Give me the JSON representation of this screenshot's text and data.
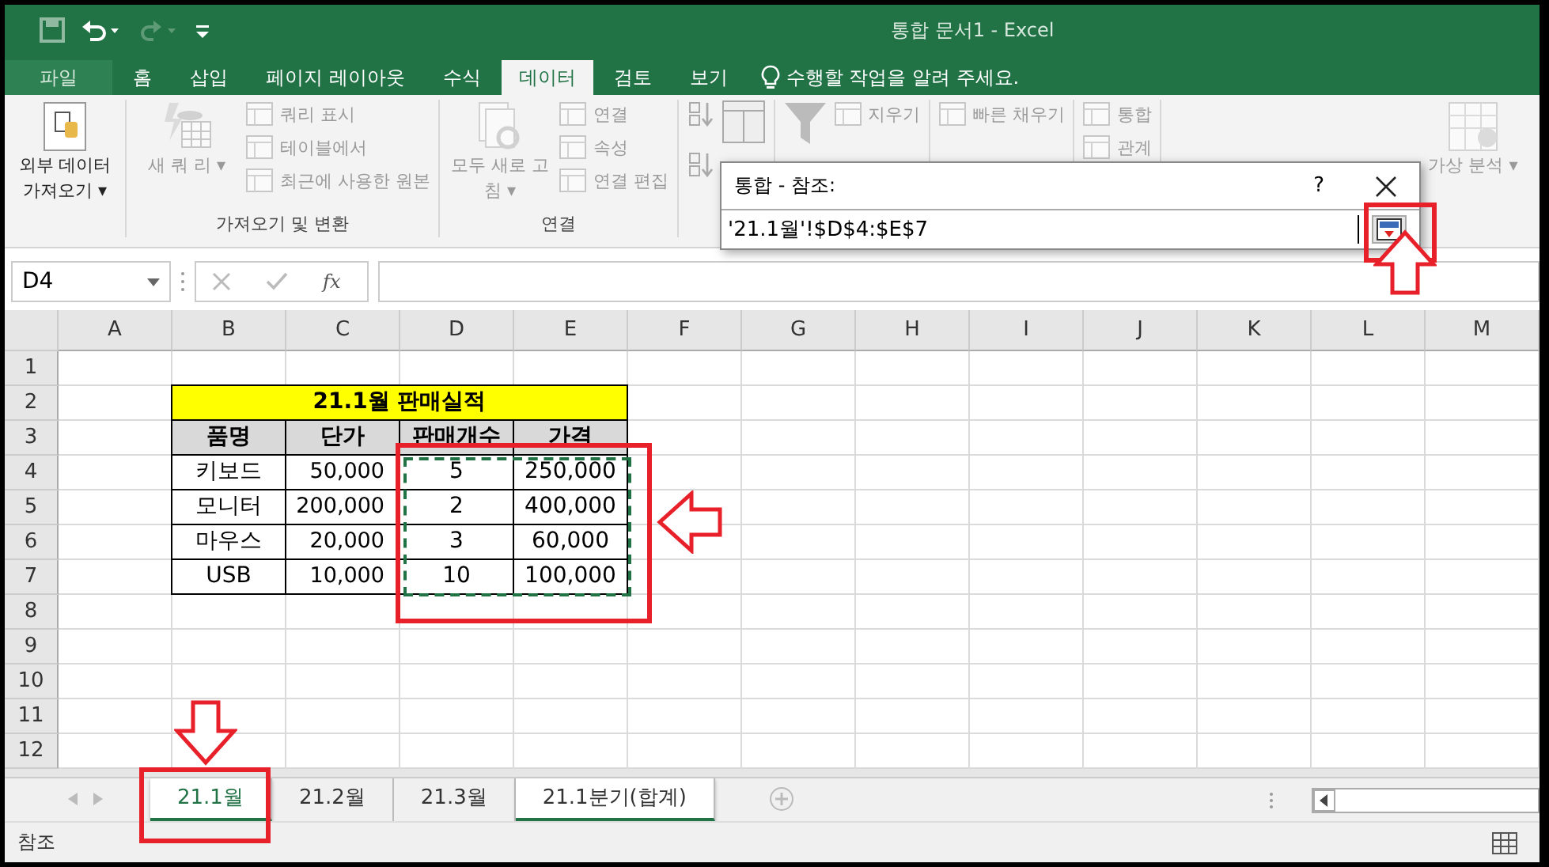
{
  "window": {
    "title": "통합 문서1 - Excel"
  },
  "tabs": [
    {
      "label": "파일",
      "selected": false,
      "kind": "file"
    },
    {
      "label": "홈",
      "selected": false,
      "kind": "tab"
    },
    {
      "label": "삽입",
      "selected": false,
      "kind": "tab"
    },
    {
      "label": "페이지 레이아웃",
      "selected": false,
      "kind": "tab"
    },
    {
      "label": "수식",
      "selected": false,
      "kind": "tab"
    },
    {
      "label": "데이터",
      "selected": true,
      "kind": "tab"
    },
    {
      "label": "검토",
      "selected": false,
      "kind": "tab"
    },
    {
      "label": "보기",
      "selected": false,
      "kind": "tab"
    }
  ],
  "tell_me": "수행할 작업을 알려 주세요.",
  "ribbon": [
    {
      "large": {
        "text": "외부 데이터 가져오기 ▾",
        "disabled": false
      }
    },
    {
      "label": "가져오기 및 변환",
      "large": {
        "text": "새 쿼 리 ▾",
        "disabled": true
      },
      "items": [
        {
          "text": "쿼리 표시",
          "disabled": true
        },
        {
          "text": "테이블에서",
          "disabled": true
        },
        {
          "text": "최근에 사용한 원본",
          "disabled": true
        }
      ]
    },
    {
      "label": "연결",
      "large": {
        "text": "모두 새로 고침 ▾",
        "disabled": true
      },
      "items": [
        {
          "text": "연결",
          "disabled": true
        },
        {
          "text": "속성",
          "disabled": true
        },
        {
          "text": "연결 편집",
          "disabled": true
        }
      ]
    },
    {
      "kind": "sort"
    },
    {
      "kind": "filter",
      "items": [
        {
          "text": "지우기",
          "disabled": true
        }
      ]
    },
    {
      "items": [
        {
          "text": "빠른 채우기",
          "disabled": true
        }
      ]
    },
    {
      "items": [
        {
          "text": "통합",
          "disabled": true
        },
        {
          "text": "관계",
          "disabled": true
        }
      ]
    },
    {
      "large": {
        "text": "가상 분석 ▾",
        "disabled": true
      }
    }
  ],
  "name_box": "D4",
  "function_label": "fx",
  "dialog": {
    "title": "통합 - 참조:",
    "help": "?",
    "value": "'21.1월'!$D$4:$E$7"
  },
  "sheet": {
    "columns": [
      "A",
      "B",
      "C",
      "D",
      "E",
      "F",
      "G",
      "H",
      "I",
      "J",
      "K",
      "L",
      "M"
    ],
    "rows": [
      "1",
      "2",
      "3",
      "4",
      "5",
      "6",
      "7",
      "8",
      "9",
      "10",
      "11",
      "12"
    ]
  },
  "table": {
    "title": "21.1월 판매실적",
    "header": [
      "품명",
      "단가",
      "판매개수",
      "가격"
    ],
    "rows": [
      [
        "키보드",
        "50,000",
        "5",
        "250,000"
      ],
      [
        "모니터",
        "200,000",
        "2",
        "400,000"
      ],
      [
        "마우스",
        "20,000",
        "3",
        "60,000"
      ],
      [
        "USB",
        "10,000",
        "10",
        "100,000"
      ]
    ]
  },
  "sheet_tabs": [
    {
      "label": "21.1월",
      "selected": true,
      "active": true
    },
    {
      "label": "21.2월",
      "selected": false,
      "active": false
    },
    {
      "label": "21.3월",
      "selected": false,
      "active": false
    },
    {
      "label": "21.1분기(합계)",
      "selected": false,
      "active": true
    }
  ],
  "status": "참조"
}
